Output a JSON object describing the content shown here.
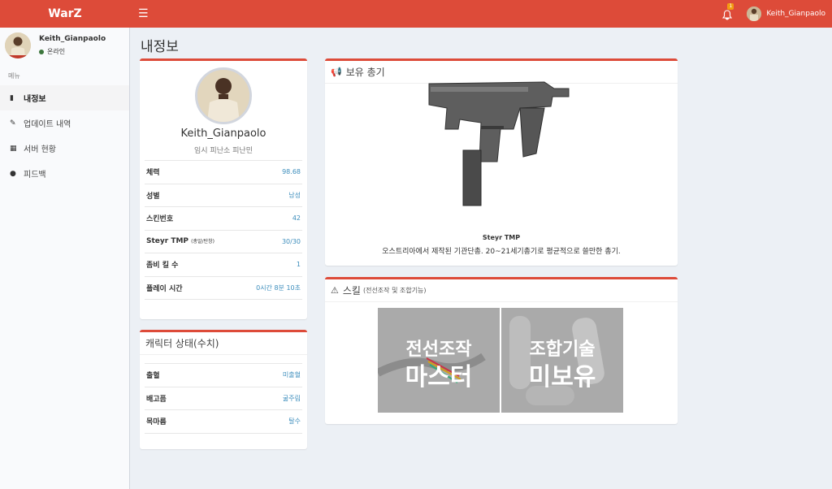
{
  "header": {
    "brand": "WarZ",
    "menu_icon": "hamburger-icon",
    "notification_icon": "bell-icon",
    "notification_count": "1",
    "username": "Keith_Gianpaolo",
    "accent_color": "#dd4b39"
  },
  "sidebar": {
    "username": "Keith_Gianpaolo",
    "status": "온라인",
    "menu_header": "메뉴",
    "items": [
      {
        "label": "내정보",
        "icon": "book-icon",
        "active": true
      },
      {
        "label": "업데이트 내역",
        "icon": "edit-icon",
        "active": false
      },
      {
        "label": "서버 현황",
        "icon": "grid-icon",
        "active": false
      },
      {
        "label": "피드백",
        "icon": "comment-icon",
        "active": false
      }
    ]
  },
  "page": {
    "title": "내정보"
  },
  "profile": {
    "name": "Keith_Gianpaolo",
    "subtitle": "임시 피난소 피난민",
    "rows": [
      {
        "key": "체력",
        "value": "98.68"
      },
      {
        "key": "성별",
        "value": "남성"
      },
      {
        "key": "스킨번호",
        "value": "42"
      },
      {
        "key": "Steyr TMP",
        "key_note": "(총알/탄창)",
        "value": "30/30"
      },
      {
        "key": "좀비 킬 수",
        "value": "1"
      },
      {
        "key": "플레이 시간",
        "value": "0시간 8분 10초"
      }
    ]
  },
  "character_status": {
    "title": "캐릭터 상태(수치)",
    "rows": [
      {
        "key": "출혈",
        "value": "미출혈"
      },
      {
        "key": "배고픔",
        "value": "굶주림"
      },
      {
        "key": "목마름",
        "value": "탈수"
      }
    ]
  },
  "weapons": {
    "title": "보유 총기",
    "icon": "bullhorn-icon",
    "name": "Steyr TMP",
    "description": "오스트리아에서 제작된 기관단총. 20~21세기총기로 평균적으로 쓸만한 총기."
  },
  "skills": {
    "title": "스킬",
    "subtitle": "(전선조작 및 조합기능)",
    "icon": "warning-icon",
    "cards": [
      {
        "line1": "전선조작",
        "line2": "마스터"
      },
      {
        "line1": "조합기술",
        "line2": "미보유"
      }
    ]
  }
}
